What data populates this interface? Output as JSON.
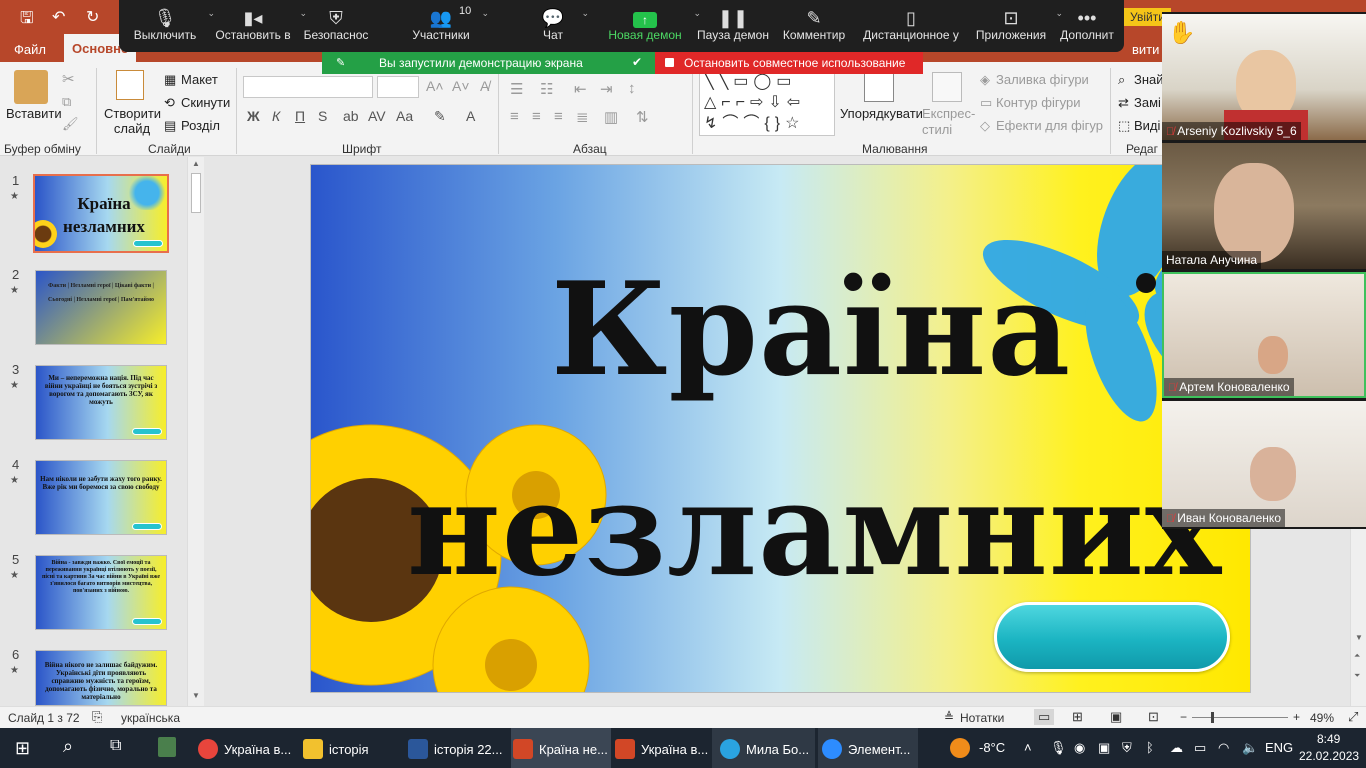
{
  "app": {
    "tabs": [
      "Файл",
      "Основне"
    ],
    "right_button": "Увійти"
  },
  "ribbon": {
    "clipboard": {
      "paste": "Вставити",
      "label": "Буфер обміну"
    },
    "slides": {
      "new_slide": "Створити слайд",
      "layout": "Макет",
      "reset": "Скинути",
      "section": "Розділ",
      "label": "Слайди"
    },
    "font": {
      "label": "Шрифт",
      "bold": "Ж",
      "italic": "К",
      "underline": "П",
      "strike": "S"
    },
    "paragraph": {
      "label": "Абзац"
    },
    "drawing": {
      "arrange": "Упорядкувати",
      "quick_styles": "Експрес-стилі",
      "fill": "Заливка фігури",
      "outline": "Контур фігури",
      "effects": "Ефекти для фігур",
      "label": "Малювання"
    },
    "editing": {
      "find": "Знай",
      "replace": "Замі",
      "select": "Виді",
      "label": "Редаг"
    }
  },
  "zoom_toolbar": {
    "items": [
      {
        "label": "Выключить",
        "icon": "microphone-icon"
      },
      {
        "label": "Остановить в",
        "icon": "video-camera-icon"
      },
      {
        "label": "Безопаснос",
        "icon": "shield-icon"
      },
      {
        "label": "Участники",
        "icon": "participants-icon",
        "count": "10"
      },
      {
        "label": "Чат",
        "icon": "chat-icon"
      },
      {
        "label": "Новая демон",
        "icon": "share-screen-icon"
      },
      {
        "label": "Пауза демон",
        "icon": "pause-icon"
      },
      {
        "label": "Комментир",
        "icon": "pen-icon"
      },
      {
        "label": "Дистанционное у",
        "icon": "mouse-icon"
      },
      {
        "label": "Приложения",
        "icon": "apps-icon"
      },
      {
        "label": "Дополнит",
        "icon": "more-icon"
      }
    ],
    "share_banner": "Вы запустили демонстрацию экрана",
    "stop_banner": "Остановить совместное использование",
    "accent_green": "#24a046",
    "accent_red": "#e02828"
  },
  "thumbnails": [
    {
      "num": "1",
      "text": "Країна незламних"
    },
    {
      "num": "2",
      "text": "Факти | Незламні герої | Цікаві факти | Сьогодні | Незламні герої | Пам'ятаймо"
    },
    {
      "num": "3",
      "text": "Ми – непереможна нація. Під час війни українці не бояться зустрічі з ворогом та допомагають ЗСУ, як можуть"
    },
    {
      "num": "4",
      "text": "Нам ніколи не забути жаху того ранку. Вже рік ми боремося за свою свободу"
    },
    {
      "num": "5",
      "text": "Війна - завжди важко. Свої емоції та переживання українці втілюють у поезії, пісні та картини За час війни в Україні вже з'явилося багато витворів мистецтва, пов'язаних з війною."
    },
    {
      "num": "6",
      "text": "Війна нікого не залишає байдужим. Українські діти проявляють справжню мужність та героїзм, допомагають фізично, морально та матеріально"
    }
  ],
  "slide": {
    "title_line1": "Країна",
    "title_line2": "незламних"
  },
  "participants": [
    {
      "name": "Arseniy Kozlivskiy 5_6",
      "muted": true,
      "hand_raised": true
    },
    {
      "name": "Натала Анучина",
      "muted": false,
      "hand_raised": false
    },
    {
      "name": "Артем Коноваленко",
      "muted": true,
      "hand_raised": false
    },
    {
      "name": "Иван Коноваленко",
      "muted": true,
      "hand_raised": false
    }
  ],
  "status": {
    "slide_info": "Слайд 1 з 72",
    "language": "українська",
    "notes": "Нотатки",
    "zoom": "49%"
  },
  "taskbar": {
    "apps": [
      {
        "label": "Україна в...",
        "icon": "chrome-icon",
        "color": "#e8453c"
      },
      {
        "label": "історія",
        "icon": "folder-icon",
        "color": "#f2c12e"
      },
      {
        "label": "історія 22...",
        "icon": "word-icon",
        "color": "#2b579a"
      },
      {
        "label": "Країна не...",
        "icon": "powerpoint-icon",
        "color": "#d24726"
      },
      {
        "label": "Україна в...",
        "icon": "powerpoint-icon",
        "color": "#d24726"
      },
      {
        "label": "Мила Бо...",
        "icon": "telegram-icon",
        "color": "#2aa3e0"
      },
      {
        "label": "Элемент...",
        "icon": "zoom-icon",
        "color": "#2d8cff"
      }
    ],
    "weather": "-8°C",
    "lang": "ENG",
    "time": "8:49",
    "date": "22.02.2023"
  }
}
